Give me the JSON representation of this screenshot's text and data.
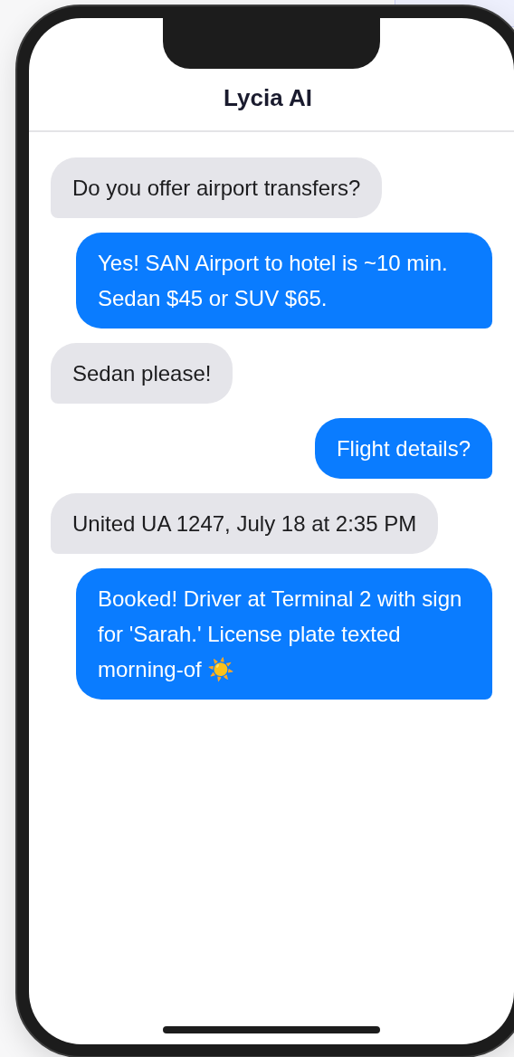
{
  "header": {
    "title": "Lycia AI"
  },
  "messages": [
    {
      "kind": "incoming",
      "text": "Do you offer airport transfers?"
    },
    {
      "kind": "outgoing",
      "text": "Yes! SAN Airport to hotel is ~10 min. Sedan $45 or SUV $65."
    },
    {
      "kind": "incoming",
      "text": "Sedan please!"
    },
    {
      "kind": "outgoing",
      "text": "Flight details?"
    },
    {
      "kind": "incoming",
      "text": "United UA 1247, July 18 at 2:35 PM"
    },
    {
      "kind": "outgoing",
      "text": "Booked! Driver at Terminal 2 with sign for 'Sarah.' License plate texted morning-of ☀️"
    }
  ]
}
